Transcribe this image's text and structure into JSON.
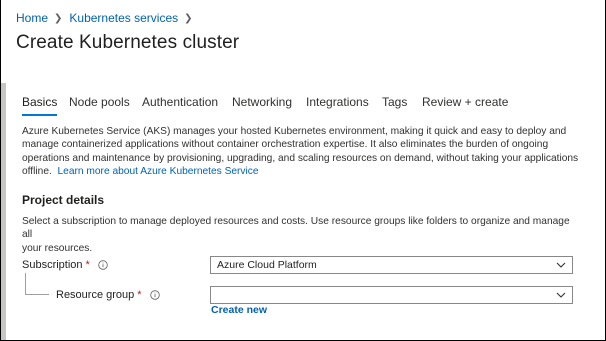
{
  "breadcrumb": [
    {
      "label": "Home"
    },
    {
      "label": "Kubernetes services"
    }
  ],
  "title": "Create Kubernetes cluster",
  "tabs": [
    {
      "label": "Basics",
      "active": true
    },
    {
      "label": "Node pools",
      "active": false
    },
    {
      "label": "Authentication",
      "active": false
    },
    {
      "label": "Networking",
      "active": false
    },
    {
      "label": "Integrations",
      "active": false
    },
    {
      "label": "Tags",
      "active": false
    },
    {
      "label": "Review + create",
      "active": false
    }
  ],
  "description": {
    "line1": "Azure Kubernetes Service (AKS) manages your hosted Kubernetes environment, making it quick and easy to deploy and",
    "line2": "manage containerized applications without container orchestration expertise. It also eliminates the burden of ongoing",
    "line3": "operations and maintenance by provisioning, upgrading, and scaling resources on demand, without taking your applications",
    "line4": "offline.",
    "link": "Learn more about Azure Kubernetes Service"
  },
  "project": {
    "title": "Project details",
    "text1": "Select a subscription to manage deployed resources and costs. Use resource groups like folders to organize and manage all",
    "text2": "your resources.",
    "subscription": {
      "label": "Subscription",
      "required": "*",
      "value": "Azure Cloud Platform"
    },
    "resource_group": {
      "label": "Resource group",
      "required": "*",
      "value": ""
    },
    "create_new": "Create new"
  },
  "colors": {
    "accent": "#0078d4",
    "link": "#0062b1",
    "required": "#a4262c"
  },
  "icons": {
    "info": "info-icon",
    "chevron": "chevron-down-icon",
    "breadcrumb_sep": "chevron-right-icon"
  }
}
